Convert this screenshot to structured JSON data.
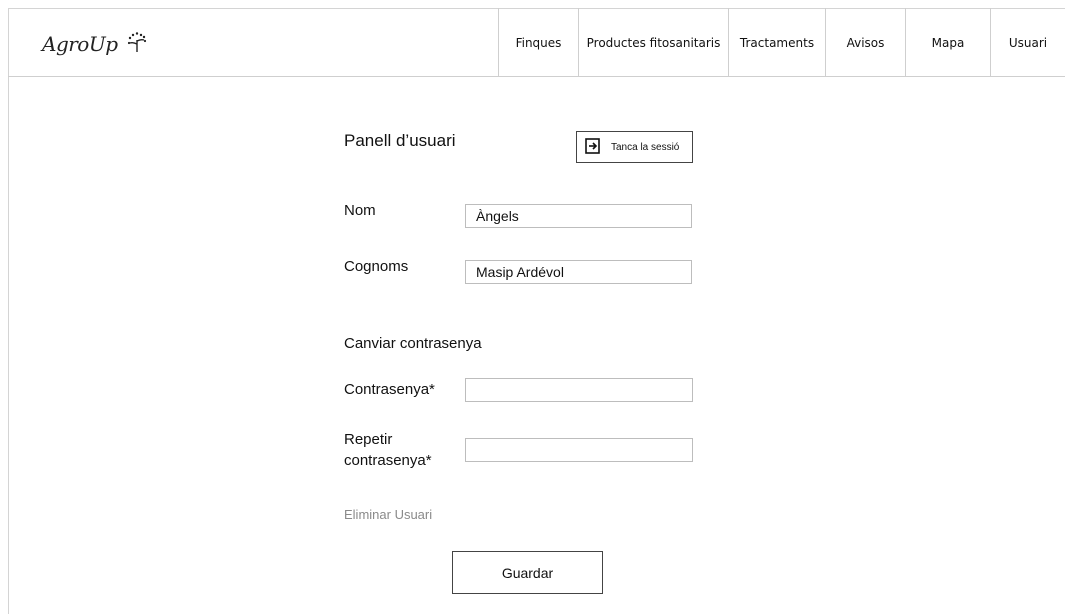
{
  "brand": {
    "name": "AgroUp",
    "logo_icon": "sprout-icon"
  },
  "nav": [
    {
      "id": "finques",
      "label": "Finques"
    },
    {
      "id": "productes",
      "label": "Productes fitosanitaris"
    },
    {
      "id": "tractaments",
      "label": "Tractaments"
    },
    {
      "id": "avisos",
      "label": "Avisos"
    },
    {
      "id": "mapa",
      "label": "Mapa"
    },
    {
      "id": "usuari",
      "label": "Usuari"
    }
  ],
  "panel": {
    "title": "Panell d’usuari",
    "logout_label": "Tanca la sessió",
    "logout_icon": "logout-icon"
  },
  "form": {
    "nom_label": "Nom",
    "nom_value": "Àngels",
    "cognoms_label": "Cognoms",
    "cognoms_value": "Masip Ardévol",
    "section_title": "Canviar contrasenya",
    "password_label": "Contrasenya*",
    "password_value": "",
    "repeat_label_line1": "Repetir",
    "repeat_label_line2": "contrasenya*",
    "repeat_value": ""
  },
  "actions": {
    "delete_label": "Eliminar Usuari",
    "save_label": "Guardar"
  }
}
